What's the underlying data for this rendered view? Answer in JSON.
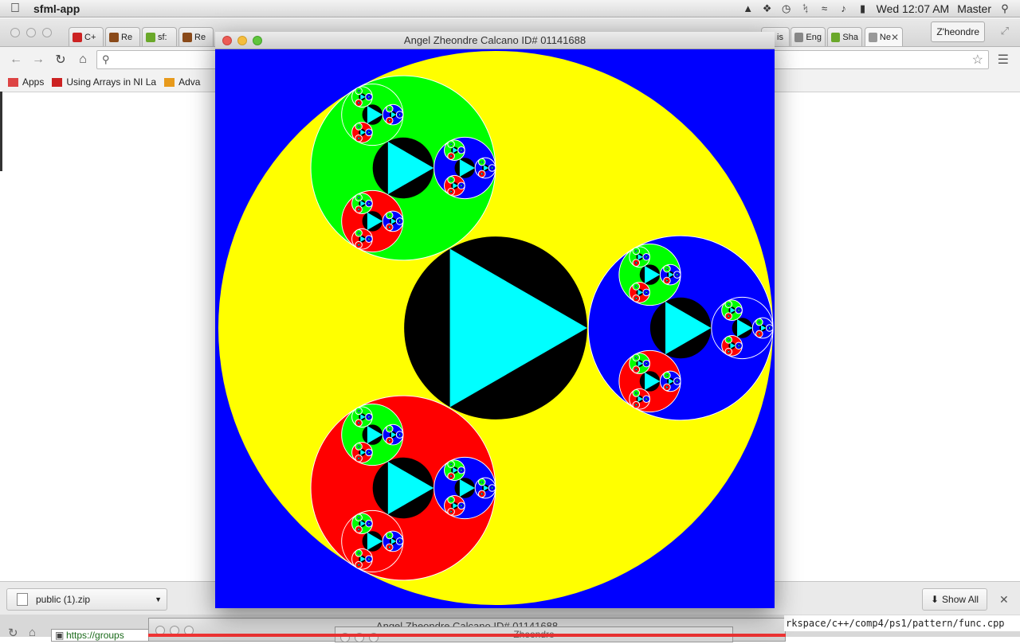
{
  "menubar": {
    "app_name": "sfml-app",
    "clock": "Wed 12:07 AM",
    "user": "Master",
    "icons": [
      "apple-icon",
      "notification-icon",
      "dropbox-icon",
      "time-machine-icon",
      "bluetooth-icon",
      "wifi-icon",
      "volume-icon",
      "battery-icon",
      "spotlight-icon"
    ]
  },
  "chrome": {
    "tabs": [
      {
        "label": "C+",
        "color": "#cc2222"
      },
      {
        "label": "Re",
        "color": "#8a4a1a"
      },
      {
        "label": "sf:",
        "color": "#6aa82a"
      },
      {
        "label": "Re",
        "color": "#8a4a1a"
      },
      {
        "label": "is",
        "color": "#777777"
      },
      {
        "label": "Eng",
        "color": "#888888"
      },
      {
        "label": "Sha",
        "color": "#6aa82a"
      },
      {
        "label": "Ne",
        "color": "#999999"
      }
    ],
    "profile": "Z'heondre",
    "address_placeholder": "",
    "bookmarks": [
      {
        "label": "Apps",
        "icon": "apps-grid-icon",
        "color": "#d44"
      },
      {
        "label": "Using Arrays in NI La",
        "icon": "youtube-icon",
        "color": "#cc2222"
      },
      {
        "label": "Adva",
        "icon": "bookmark-icon",
        "color": "#e79a1c"
      }
    ]
  },
  "downloads": {
    "file": "public (1).zip",
    "show_all": "Show All"
  },
  "background_windows": {
    "url_prefix": "https://groups",
    "title2": "Angel Zheondre Calcano ID# 01141688",
    "title3": "Zheondre",
    "path": "rkspace/c++/comp4/ps1/pattern/func.cpp"
  },
  "sfml_window": {
    "title": "Angel Zheondre Calcano ID# 01141688"
  },
  "fractal": {
    "colors": {
      "background": "#0000ff",
      "outer": "#ffff00",
      "core": "#000000",
      "triangle": "#00ffff",
      "child1": "#00ff00",
      "child2": "#0000ff",
      "child3": "#ff0000"
    },
    "depth": 4
  }
}
